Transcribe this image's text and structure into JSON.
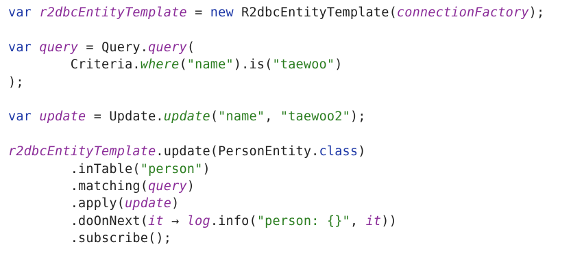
{
  "code": {
    "language": "kotlin",
    "colors": {
      "keyword": "#1c37a6",
      "field": "#8a2b98",
      "static": "#2a7d1f",
      "string": "#2a7d1f",
      "plain": "#1f1f1f"
    },
    "lines": [
      [
        {
          "t": "var",
          "c": "kw"
        },
        {
          "t": " ",
          "c": "pl"
        },
        {
          "t": "r2dbcEntityTemplate",
          "c": "fld"
        },
        {
          "t": " = ",
          "c": "pl"
        },
        {
          "t": "new",
          "c": "kw"
        },
        {
          "t": " R2dbcEntityTemplate(",
          "c": "pl"
        },
        {
          "t": "connectionFactory",
          "c": "fld"
        },
        {
          "t": ");",
          "c": "pl"
        }
      ],
      [],
      [
        {
          "t": "var",
          "c": "kw"
        },
        {
          "t": " ",
          "c": "pl"
        },
        {
          "t": "query",
          "c": "fld"
        },
        {
          "t": " = Query.",
          "c": "pl"
        },
        {
          "t": "query",
          "c": "fld"
        },
        {
          "t": "(",
          "c": "pl"
        }
      ],
      [
        {
          "t": "        Criteria.",
          "c": "pl"
        },
        {
          "t": "where",
          "c": "st"
        },
        {
          "t": "(",
          "c": "pl"
        },
        {
          "t": "\"name\"",
          "c": "str"
        },
        {
          "t": ").is(",
          "c": "pl"
        },
        {
          "t": "\"taewoo\"",
          "c": "str"
        },
        {
          "t": ")",
          "c": "pl"
        }
      ],
      [
        {
          "t": ");",
          "c": "pl"
        }
      ],
      [],
      [
        {
          "t": "var",
          "c": "kw"
        },
        {
          "t": " ",
          "c": "pl"
        },
        {
          "t": "update",
          "c": "fld"
        },
        {
          "t": " = Update.",
          "c": "pl"
        },
        {
          "t": "update",
          "c": "st"
        },
        {
          "t": "(",
          "c": "pl"
        },
        {
          "t": "\"name\"",
          "c": "str"
        },
        {
          "t": ", ",
          "c": "pl"
        },
        {
          "t": "\"taewoo2\"",
          "c": "str"
        },
        {
          "t": ");",
          "c": "pl"
        }
      ],
      [],
      [
        {
          "t": "r2dbcEntityTemplate",
          "c": "fld"
        },
        {
          "t": ".update(PersonEntity.",
          "c": "pl"
        },
        {
          "t": "class",
          "c": "kw"
        },
        {
          "t": ")",
          "c": "pl"
        }
      ],
      [
        {
          "t": "        .inTable(",
          "c": "pl"
        },
        {
          "t": "\"person\"",
          "c": "str"
        },
        {
          "t": ")",
          "c": "pl"
        }
      ],
      [
        {
          "t": "        .matching(",
          "c": "pl"
        },
        {
          "t": "query",
          "c": "fld"
        },
        {
          "t": ")",
          "c": "pl"
        }
      ],
      [
        {
          "t": "        .apply(",
          "c": "pl"
        },
        {
          "t": "update",
          "c": "fld"
        },
        {
          "t": ")",
          "c": "pl"
        }
      ],
      [
        {
          "t": "        .doOnNext(",
          "c": "pl"
        },
        {
          "t": "it",
          "c": "fld"
        },
        {
          "t": " → ",
          "c": "pl"
        },
        {
          "t": "log",
          "c": "fld"
        },
        {
          "t": ".info(",
          "c": "pl"
        },
        {
          "t": "\"person: {}\"",
          "c": "str"
        },
        {
          "t": ", ",
          "c": "pl"
        },
        {
          "t": "it",
          "c": "fld"
        },
        {
          "t": "))",
          "c": "pl"
        }
      ],
      [
        {
          "t": "        .subscribe();",
          "c": "pl"
        }
      ]
    ]
  }
}
